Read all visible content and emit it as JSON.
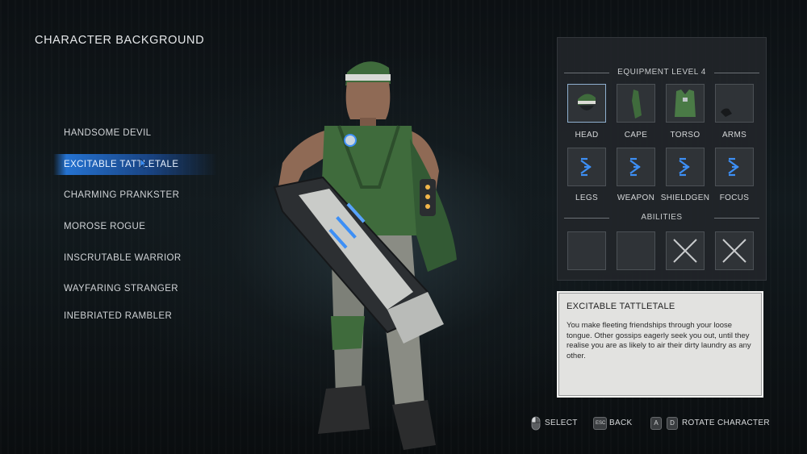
{
  "screen": {
    "title": "CHARACTER BACKGROUND"
  },
  "backgrounds": {
    "selected_index": 1,
    "items": [
      "HANDSOME DEVIL",
      "EXCITABLE TATTLETALE",
      "CHARMING PRANKSTER",
      "MOROSE ROGUE",
      "INSCRUTABLE WARRIOR",
      "WAYFARING STRANGER",
      "INEBRIATED RAMBLER"
    ]
  },
  "equipment": {
    "header": "EQUIPMENT LEVEL 4",
    "slots": [
      {
        "label": "HEAD",
        "icon": "green-bandana-icon",
        "state": "equipped"
      },
      {
        "label": "CAPE",
        "icon": "green-cape-icon",
        "state": "equipped"
      },
      {
        "label": "TORSO",
        "icon": "green-vest-icon",
        "state": "equipped"
      },
      {
        "label": "ARMS",
        "icon": "dark-arms-icon",
        "state": "equipped"
      },
      {
        "label": "LEGS",
        "icon": "blue-chevron-icon",
        "state": "unselected"
      },
      {
        "label": "WEAPON",
        "icon": "blue-chevron-icon",
        "state": "unselected"
      },
      {
        "label": "SHIELDGEN",
        "icon": "blue-chevron-icon",
        "state": "unselected"
      },
      {
        "label": "FOCUS",
        "icon": "blue-chevron-icon",
        "state": "unselected"
      }
    ]
  },
  "abilities": {
    "header": "ABILITIES",
    "slots": [
      {
        "icon": "empty-slot",
        "state": "empty"
      },
      {
        "icon": "empty-slot",
        "state": "empty"
      },
      {
        "icon": "x-mark-icon",
        "state": "locked"
      },
      {
        "icon": "x-mark-icon",
        "state": "locked"
      }
    ]
  },
  "description": {
    "title": "EXCITABLE TATTLETALE",
    "text": "You make fleeting friendships through your loose tongue. Other gossips eagerly seek you out, until they realise you are as likely to air their dirty laundry as any other."
  },
  "controls": {
    "select_label": "SELECT",
    "back_key": "ESC",
    "back_label": "BACK",
    "rotate_key_left": "A",
    "rotate_key_right": "D",
    "rotate_label": "ROTATE CHARACTER"
  },
  "colors": {
    "accent_blue": "#2f86f0",
    "slot_icon_blue": "#3d8ff5",
    "outfit_green": "#3f6b3c",
    "panel_bg": "#222629",
    "desc_bg": "#e2e2e0"
  }
}
